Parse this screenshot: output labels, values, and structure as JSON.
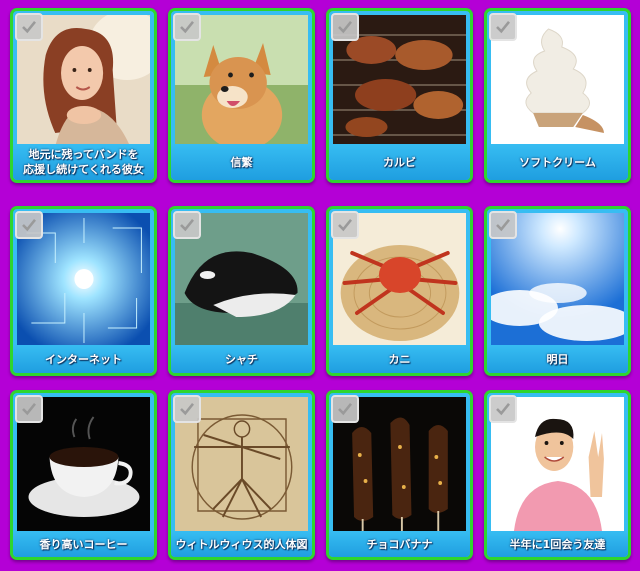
{
  "cards": [
    {
      "label": "地元に残ってバンドを\n応援し続けてくれる彼女",
      "image": "woman-photo"
    },
    {
      "label": "信繁",
      "image": "shiba-dog-photo"
    },
    {
      "label": "カルビ",
      "image": "grilled-meat-photo"
    },
    {
      "label": "ソフトクリーム",
      "image": "soft-serve-photo"
    },
    {
      "label": "インターネット",
      "image": "network-light-photo"
    },
    {
      "label": "シャチ",
      "image": "orca-photo"
    },
    {
      "label": "カニ",
      "image": "crab-photo"
    },
    {
      "label": "明日",
      "image": "sunny-sky-photo"
    },
    {
      "label": "香り高いコーヒー",
      "image": "coffee-cup-photo"
    },
    {
      "label": "ウィトルウィウス的人体図",
      "image": "vitruvian-man-photo"
    },
    {
      "label": "チョコバナナ",
      "image": "choco-banana-photo"
    },
    {
      "label": "半年に1回会う友達",
      "image": "peace-sign-man-photo"
    }
  ],
  "colors": {
    "background": "#b400d6",
    "card_border": "#2fd52f",
    "label_bg": "#37bdf2"
  },
  "icons": {
    "check": "checkmark-icon"
  }
}
